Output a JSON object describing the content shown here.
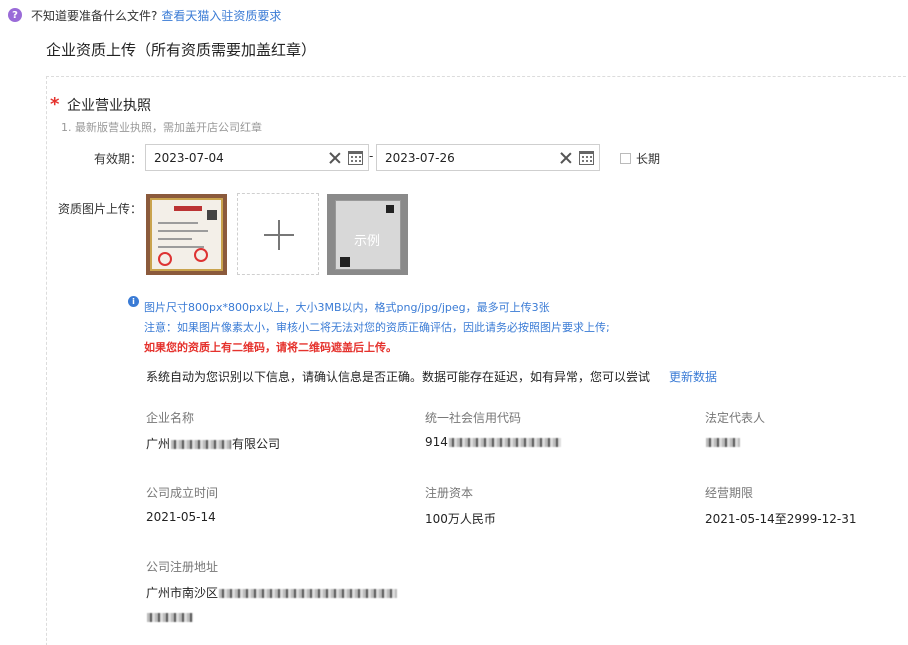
{
  "hint": {
    "text": "不知道要准备什么文件?",
    "link": "查看天猫入驻资质要求"
  },
  "section_title": "企业资质上传（所有资质需要加盖红章）",
  "license": {
    "title": "企业营业执照",
    "desc": "1. 最新版营业执照，需加盖开店公司红章",
    "validity_label": "有效期：",
    "start_date": "2023-07-04",
    "end_date": "2023-07-26",
    "range_sep": "-",
    "long_term_label": "长期",
    "upload_label": "资质图片上传：",
    "sample_label": "示例"
  },
  "tips": {
    "line1": "图片尺寸800px*800px以上，大小3MB以内，格式png/jpg/jpeg，最多可上传3张",
    "line2": "注意：如果图片像素太小，审核小二将无法对您的资质正确评估，因此请务必按照图片要求上传;",
    "line3": "如果您的资质上有二维码，请将二维码遮盖后上传。"
  },
  "notice": {
    "text": "系统自动为您识别以下信息，请确认信息是否正确。数据可能存在延迟，如有异常，您可以尝试",
    "refresh_link": "更新数据"
  },
  "fields": {
    "company_name": {
      "label": "企业名称",
      "prefix": "广州",
      "suffix": "有限公司"
    },
    "credit_code": {
      "label": "统一社会信用代码",
      "prefix": "914"
    },
    "legal_rep": {
      "label": "法定代表人"
    },
    "founded": {
      "label": "公司成立时间",
      "value": "2021-05-14"
    },
    "capital": {
      "label": "注册资本",
      "value": "100万人民币"
    },
    "term": {
      "label": "经营期限",
      "value": "2021-05-14至2999-12-31"
    },
    "address": {
      "label": "公司注册地址",
      "prefix": "广州市南沙区"
    }
  }
}
